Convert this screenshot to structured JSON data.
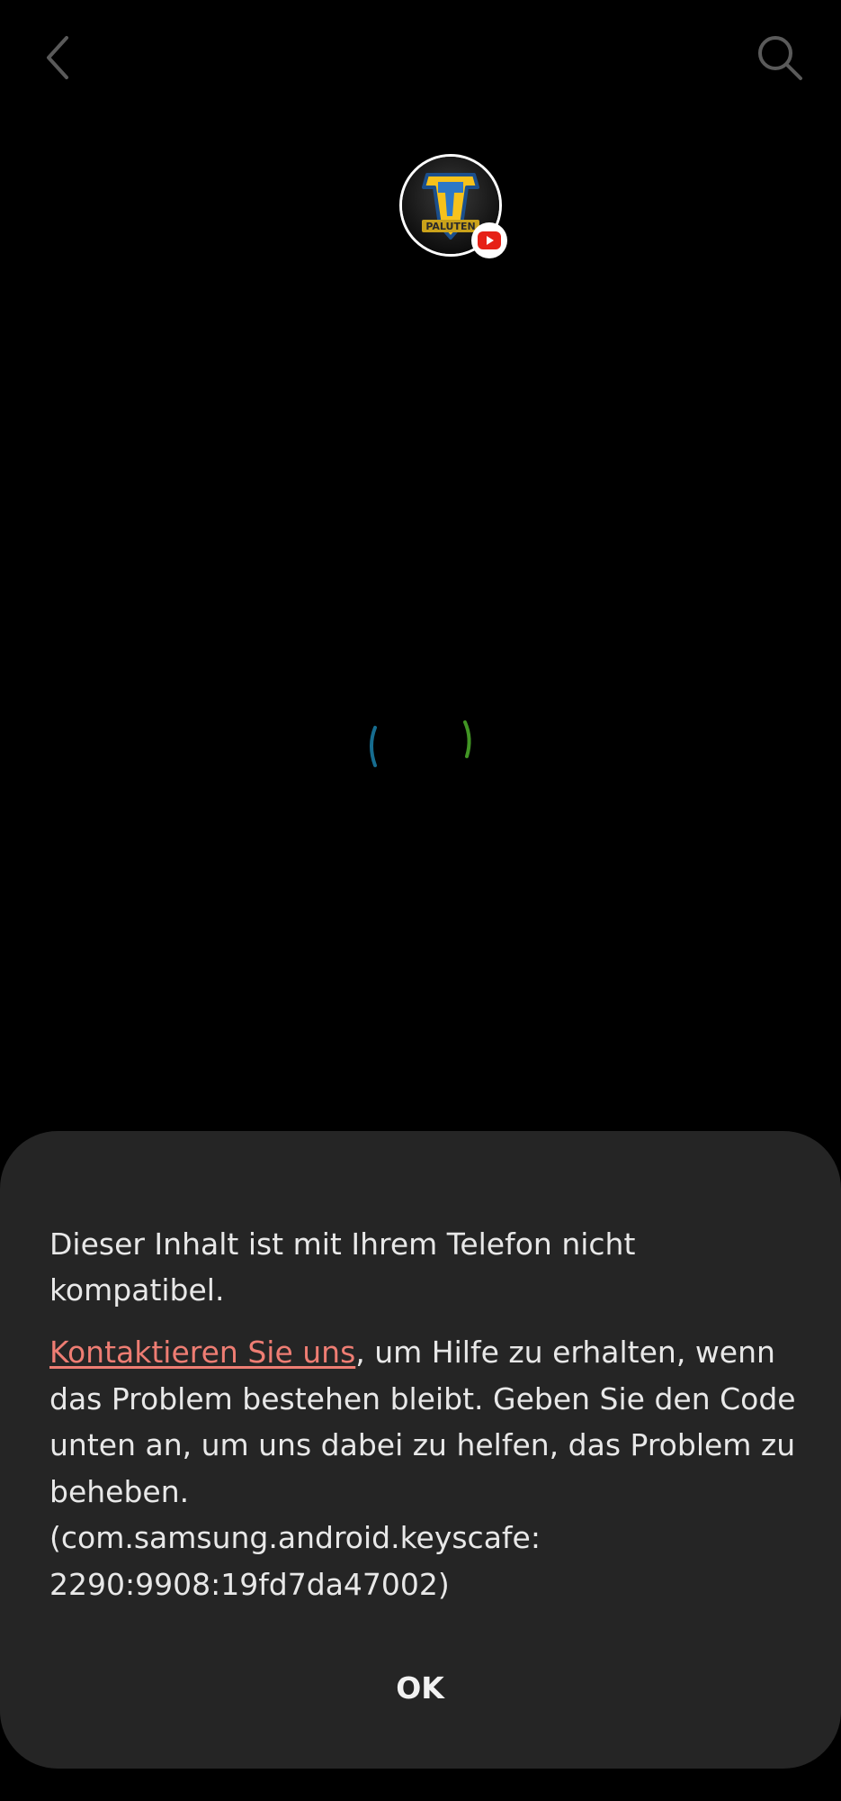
{
  "header": {
    "back_icon": "chevron-left-icon",
    "search_icon": "search-icon"
  },
  "channel": {
    "avatar_text": "PALUTEN",
    "badge_icon": "youtube-play-icon",
    "badge_color": "#e62117"
  },
  "loading": {
    "spinner_colors": [
      "#1a7fa8",
      "#4caf2a"
    ]
  },
  "dialog": {
    "title": "Dieser Inhalt ist mit Ihrem Telefon nicht kompatibel.",
    "contact_link": "Kontaktieren Sie uns",
    "body_text": ", um Hilfe zu erhalten, wenn das Problem bestehen bleibt. Geben Sie den Code unten an, um uns dabei zu helfen, das Problem zu beheben.",
    "error_code": "(com.samsung.android.keyscafe: 2290:9908:19fd7da47002)",
    "ok_label": "OK",
    "link_color": "#ee7d73",
    "background_color": "#252525"
  }
}
